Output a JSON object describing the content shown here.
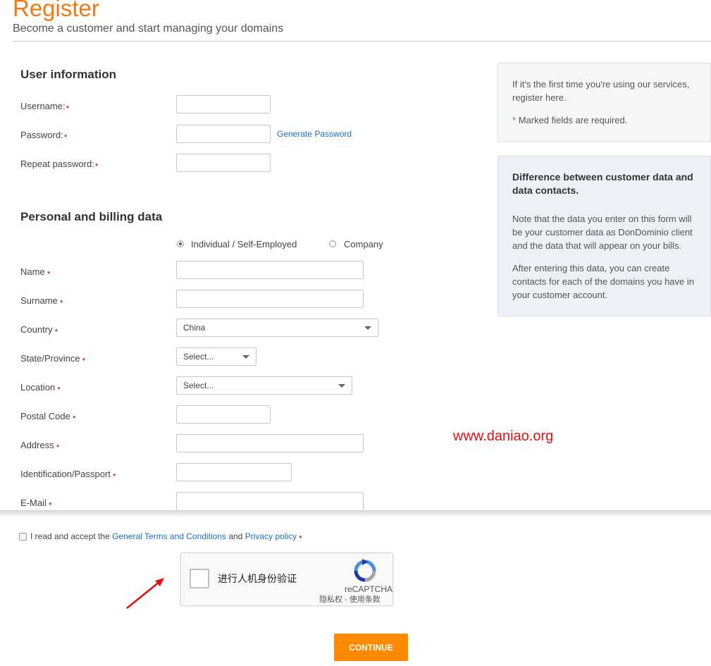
{
  "header": {
    "title": "Register",
    "subtitle": "Become a customer and start managing your domains"
  },
  "user_info": {
    "section_title": "User information",
    "username_label": "Username:",
    "password_label": "Password:",
    "repeat_password_label": "Repeat password:",
    "generate_password_link": "Generate Password"
  },
  "billing": {
    "section_title": "Personal and billing data",
    "type_options": [
      "Individual / Self-Employed",
      "Company"
    ],
    "selected_type": "Individual / Self-Employed",
    "name_label": "Name",
    "surname_label": "Surname",
    "country_label": "Country",
    "country_value": "China",
    "state_label": "State/Province",
    "state_value": "Select...",
    "location_label": "Location",
    "location_value": "Select...",
    "postal_code_label": "Postal Code",
    "address_label": "Address",
    "identification_label": "Identification/Passport",
    "email_label": "E-Mail"
  },
  "required_marker": "*",
  "info_box_1": {
    "text": "If it's the first time you're using our services, register here.",
    "required_note": "Marked fields are required."
  },
  "info_box_2": {
    "title": "Difference between customer data and data contacts.",
    "paragraph_1": "Note that the data you enter on this form will be your customer data as DonDominio client and the data that will appear on your bills.",
    "paragraph_2": "After entering this data, you can create contacts for each of the domains you have in your customer account."
  },
  "watermark": "www.daniao.org",
  "terms": {
    "prefix": "I read and accept the",
    "terms_link": "General Terms and Conditions",
    "conjunction": "and",
    "privacy_link": "Privacy policy"
  },
  "recaptcha": {
    "label": "进行人机身份验证",
    "brand": "reCAPTCHA",
    "privacy": "隐私权 - 使用条款"
  },
  "continue_button": "CONTINUE",
  "colors": {
    "brand_orange": "#f07b12",
    "button_orange": "#ff8a00",
    "link_blue": "#1a6fc4",
    "required_red": "#e0504f",
    "watermark_red": "#e01010"
  },
  "icons": {
    "recaptcha": "recaptcha-logo-icon",
    "annotation": "red-arrow-icon",
    "select": "chevron-down-icon"
  }
}
